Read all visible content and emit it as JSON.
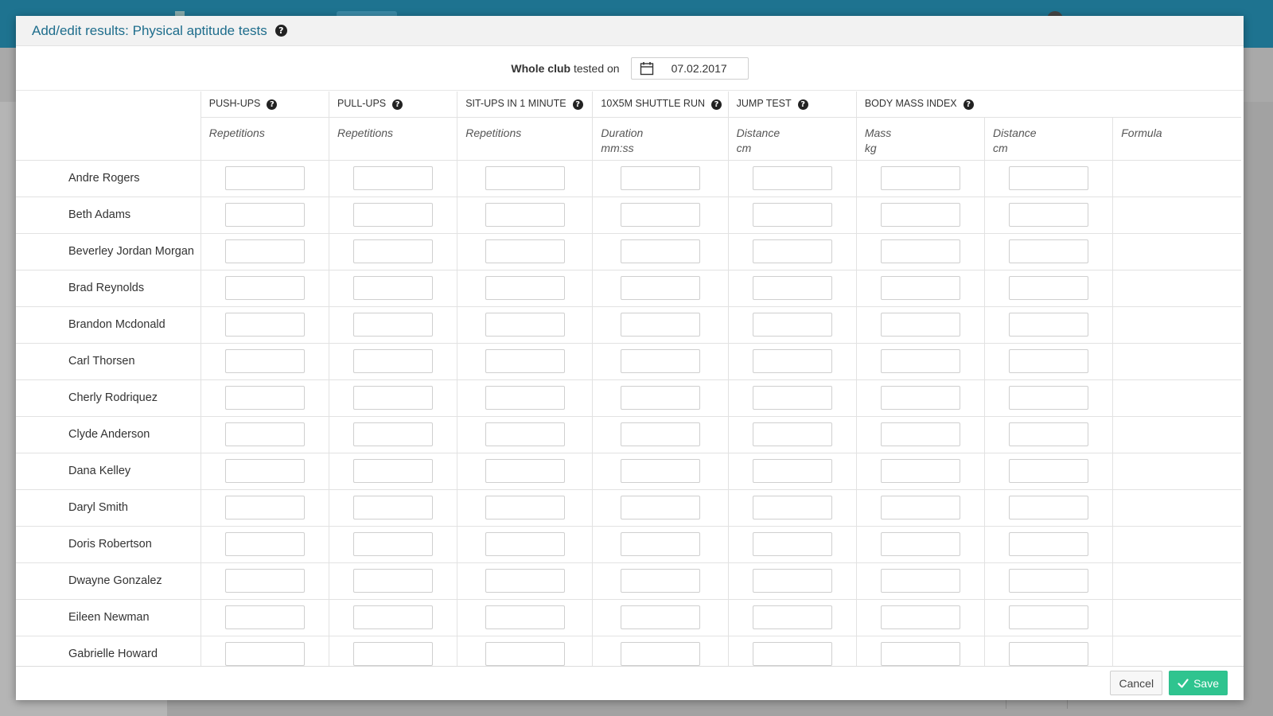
{
  "modal": {
    "title": "Add/edit results: Physical aptitude tests",
    "scope_bold": "Whole club",
    "scope_rest": " tested on",
    "date": "07.02.2017"
  },
  "columns": {
    "push_ups": {
      "label": "PUSH-UPS",
      "unit": "Repetitions"
    },
    "pull_ups": {
      "label": "PULL-UPS",
      "unit": "Repetitions"
    },
    "sit_ups": {
      "label": "SIT-UPS IN 1 MINUTE",
      "unit": "Repetitions"
    },
    "shuttle": {
      "label": "10X5M SHUTTLE RUN",
      "unit": "Duration",
      "unit2": "mm:ss"
    },
    "jump": {
      "label": "JUMP TEST",
      "unit": "Distance",
      "unit2": "cm"
    },
    "bmi": {
      "label": "BODY MASS INDEX",
      "unit_mass": "Mass",
      "unit_mass2": "kg",
      "unit_dist": "Distance",
      "unit_dist2": "cm",
      "unit_formula": "Formula"
    }
  },
  "athletes": [
    "Andre Rogers",
    "Beth Adams",
    "Beverley Jordan Morgan",
    "Brad Reynolds",
    "Brandon Mcdonald",
    "Carl Thorsen",
    "Cherly Rodriquez",
    "Clyde Anderson",
    "Dana Kelley",
    "Daryl Smith",
    "Doris Robertson",
    "Dwayne Gonzalez",
    "Eileen Newman",
    "Gabrielle Howard"
  ],
  "footer": {
    "cancel_label": "Cancel",
    "save_label": "Save"
  },
  "icons": {
    "help": "question-circle-icon",
    "calendar": "calendar-icon",
    "save": "check-icon"
  },
  "colors": {
    "header_bar": "#1e7390",
    "title": "#1e6d8c",
    "save_button": "#2fc48f"
  }
}
